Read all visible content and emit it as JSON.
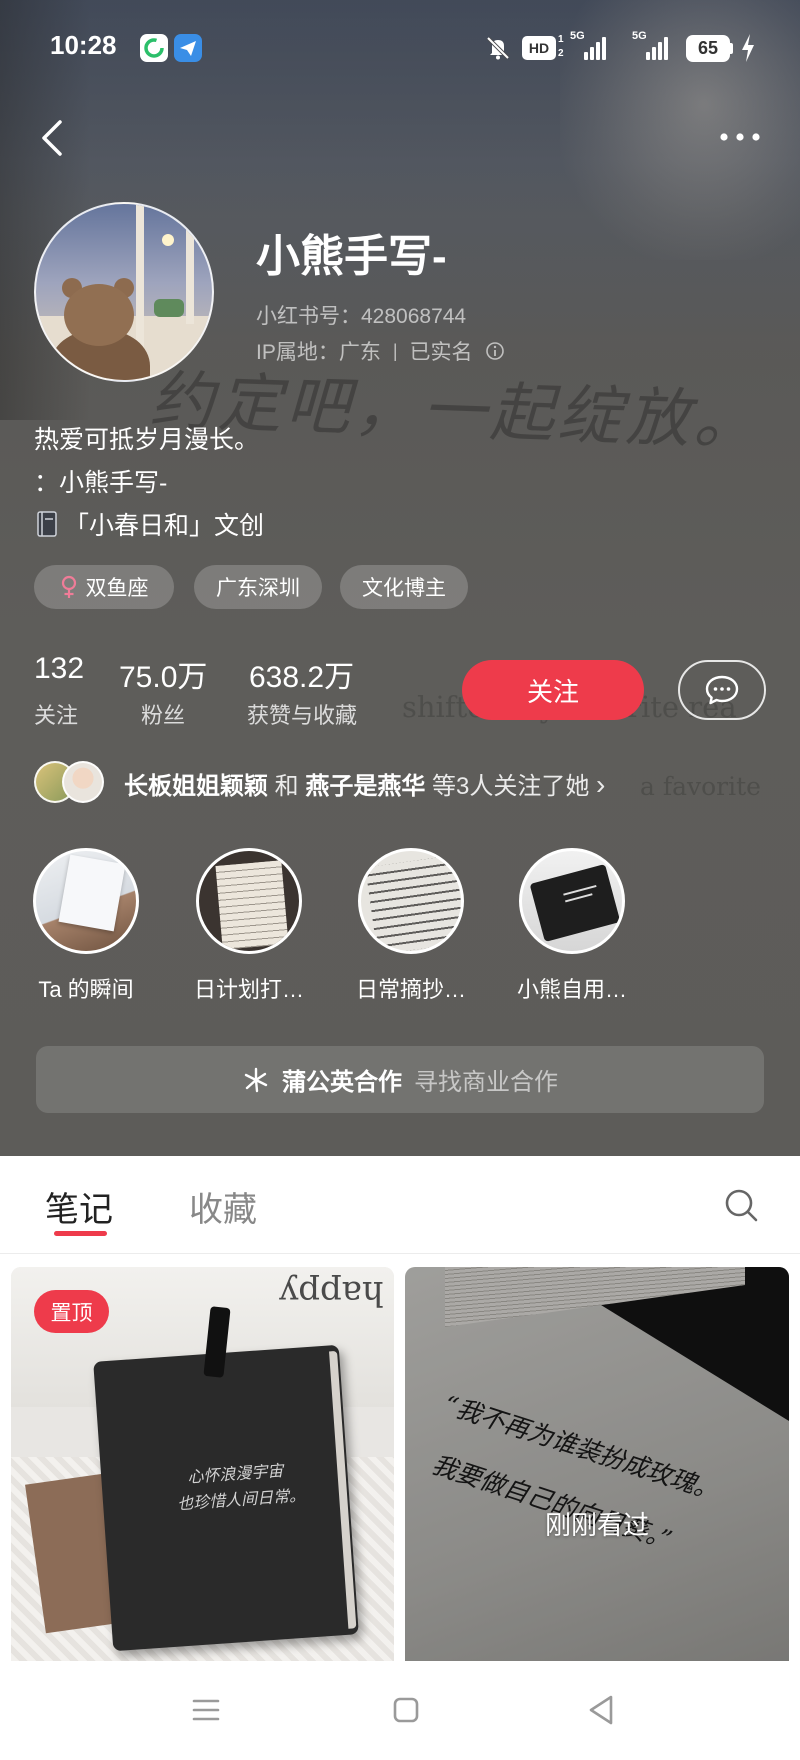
{
  "status_bar": {
    "time": "10:28",
    "hd_badge": "HD",
    "sim_slot_1": "1",
    "sim_slot_2": "2",
    "network_1": "5G",
    "network_2": "5G",
    "battery_level": "65",
    "icons": [
      "sync-app-icon",
      "paper-plane-app-icon",
      "mute-icon",
      "charging-bolt-icon"
    ]
  },
  "nav": {
    "back_icon": "chevron-left-icon",
    "more_icon": "more-dots-icon"
  },
  "background_photo_text": {
    "handwriting": "约定吧，一起绽放。",
    "print_line_1": "shifted my favorite rea",
    "print_line_2": "a favorite"
  },
  "profile": {
    "nickname": "小熊手写-",
    "red_id": "小红书号：428068744",
    "ip_location": "IP属地：广东",
    "separator": "|",
    "verified": "已实名",
    "bio": [
      "热爱可抵岁月漫长。",
      "：小熊手写-",
      "「小春日和」文创"
    ],
    "tags": [
      {
        "icon": "female-icon",
        "label": "双鱼座"
      },
      {
        "label": "广东深圳"
      },
      {
        "label": "文化博主"
      }
    ],
    "stats": [
      {
        "value": "132",
        "label": "关注"
      },
      {
        "value": "75.0万",
        "label": "粉丝"
      },
      {
        "value": "638.2万",
        "label": "获赞与收藏"
      }
    ],
    "follow_label": "关注",
    "message_icon": "chat-bubble-icon"
  },
  "mutual_followers": {
    "name_1": "长板姐姐颖颖",
    "conjunction": "和",
    "name_2": "燕子是燕华",
    "suffix": "等3人关注了她",
    "chevron": "›"
  },
  "highlights": [
    {
      "label": "Ta 的瞬间"
    },
    {
      "label": "日计划打…"
    },
    {
      "label": "日常摘抄…"
    },
    {
      "label": "小熊自用…"
    }
  ],
  "cooperation": {
    "title": "蒲公英合作",
    "subtitle": "寻找商业合作"
  },
  "tabs": [
    {
      "label": "笔记",
      "active": true
    },
    {
      "label": "收藏",
      "active": false
    }
  ],
  "notes": [
    {
      "pinned_badge": "置顶",
      "photo_text": {
        "print": "happy",
        "handwriting_line_1": "心怀浪漫宇宙",
        "handwriting_line_2": "也珍惜人间日常。"
      }
    },
    {
      "overlay_label": "刚刚看过",
      "photo_text": {
        "handwriting_line_1": "“我不再为谁装扮成玫瑰。",
        "handwriting_line_2": "我要做自己的向日葵。”"
      }
    }
  ],
  "colors": {
    "accent": "#ee3b4b",
    "header_bg": "#5d5c59",
    "female_pink": "#f07c98",
    "tab_active": "#222222",
    "tab_inactive": "#888888"
  }
}
